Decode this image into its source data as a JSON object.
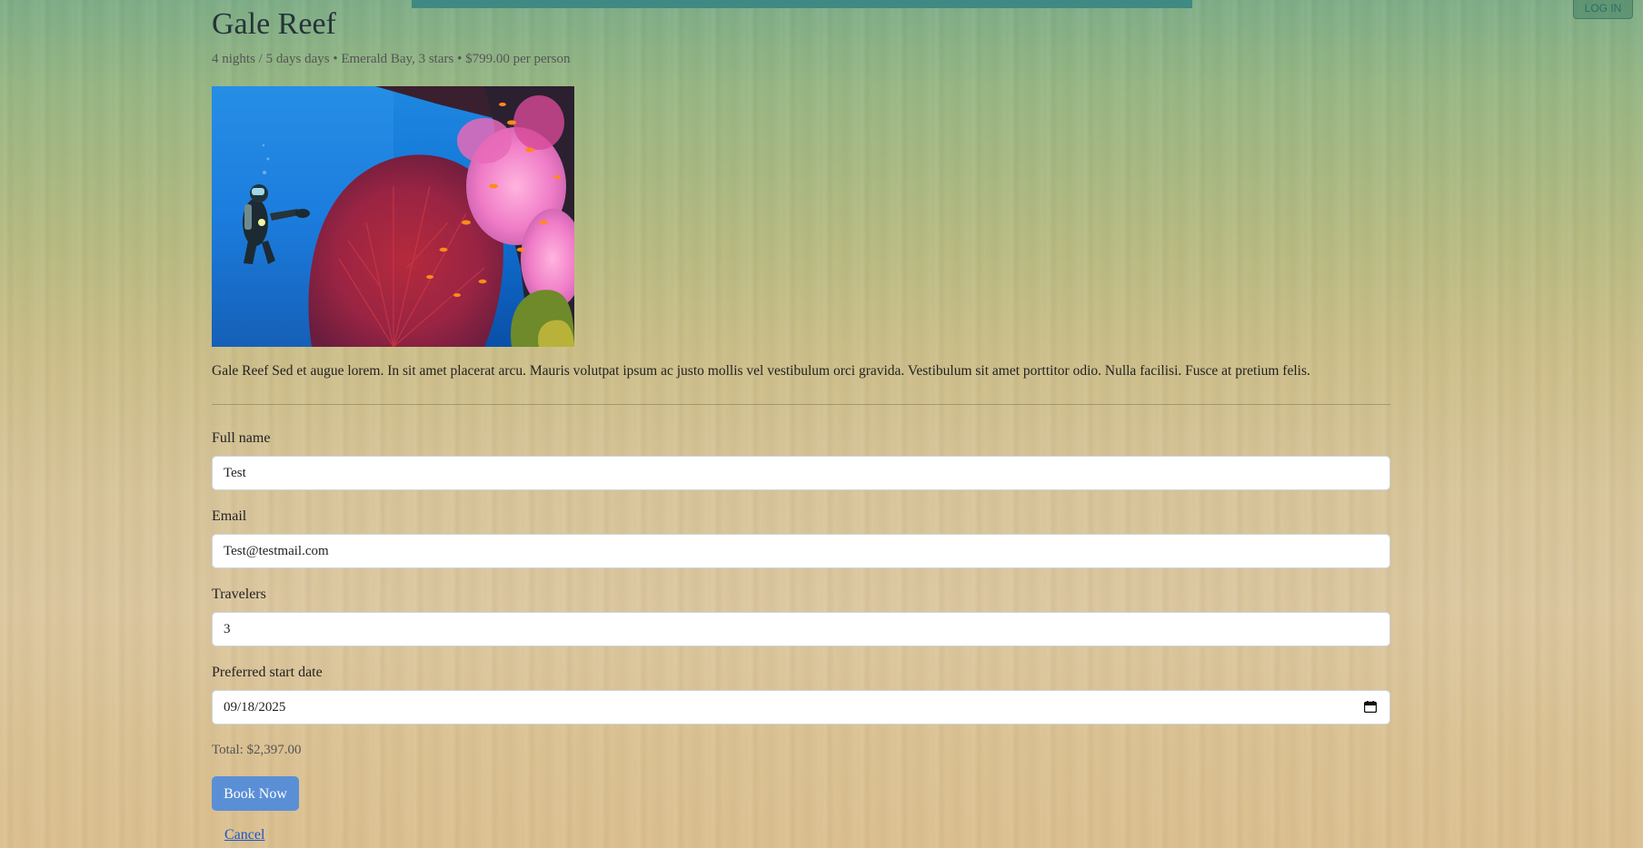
{
  "header": {
    "login_label": "LOG IN"
  },
  "tour": {
    "title": "Gale Reef",
    "meta": "4 nights / 5 days days • Emerald Bay, 3 stars • $799.00 per person",
    "image": "scuba diver beside red sea fan and pink soft coral reef",
    "description": "Gale Reef Sed et augue lorem. In sit amet placerat arcu. Mauris volutpat ipsum ac justo mollis vel vestibulum orci gravida. Vestibulum sit amet porttitor odio. Nulla facilisi. Fusce at pretium felis."
  },
  "form": {
    "full_name": {
      "label": "Full name",
      "value": "Test"
    },
    "email": {
      "label": "Email",
      "value": "Test@testmail.com"
    },
    "travelers": {
      "label": "Travelers",
      "value": "3"
    },
    "start_date": {
      "label": "Preferred start date",
      "value": "09/18/2025",
      "icon": "calendar-icon"
    },
    "total": "Total: $2,397.00",
    "book_label": "Book Now",
    "cancel_label": "Cancel"
  },
  "colors": {
    "accent_button": "#5a8fd6",
    "link": "#1a56c8",
    "top_strip": "#3e8a82"
  }
}
